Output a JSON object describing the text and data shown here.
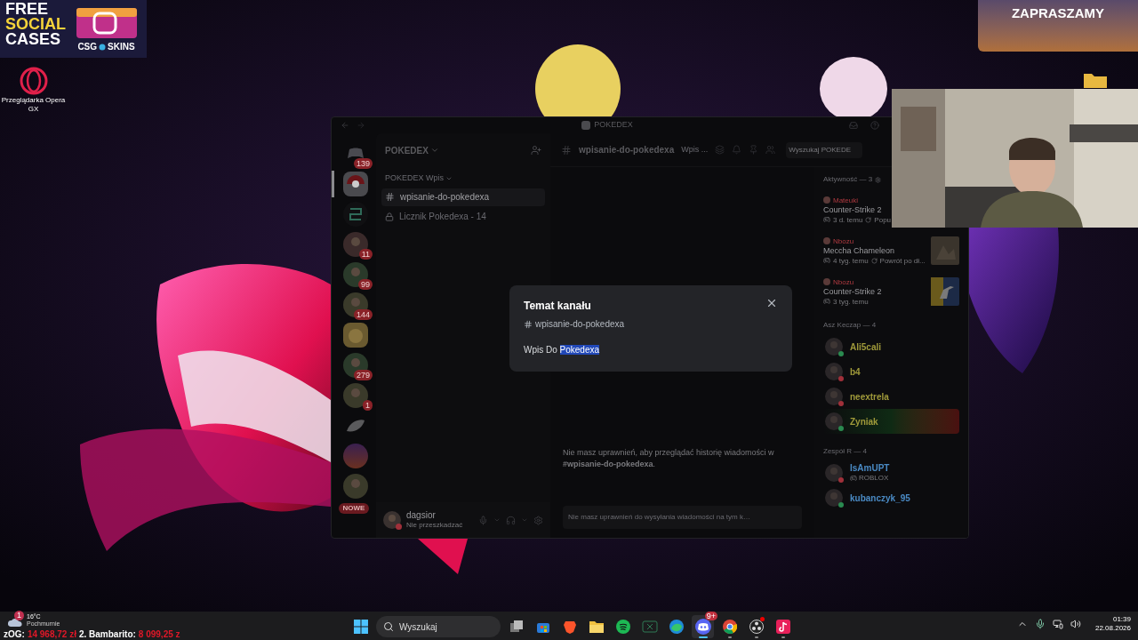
{
  "overlays": {
    "promo": {
      "lines": [
        {
          "text": "FREE",
          "color": "#ffffff"
        },
        {
          "text": "SOCIAL",
          "color": "#f5d33a"
        },
        {
          "text": "CASES",
          "color": "#ffffff"
        }
      ],
      "brand_left": "CSG",
      "brand_right": "SKINS"
    },
    "banner": {
      "title": "ZAPRASZAMY"
    },
    "ticker": [
      {
        "label": "zOG:",
        "amount": "14 968,72 zł"
      },
      {
        "label": "2. Bambarito:",
        "amount": "8 099,25 z"
      }
    ]
  },
  "desktop": {
    "icons": [
      {
        "kind": "opera",
        "label": "Przeglądarka Opera GX"
      },
      {
        "kind": "folder"
      }
    ]
  },
  "discord": {
    "title": "POKEDEX",
    "servers": [
      {
        "kind": "home",
        "badge": "139",
        "selected": false
      },
      {
        "kind": "pokeball",
        "selected": true
      },
      {
        "kind": "logo",
        "selected": false
      },
      {
        "kind": "avatar",
        "badge": "11",
        "selected": false
      },
      {
        "kind": "avatar",
        "badge": "99",
        "selected": false
      },
      {
        "kind": "avatar",
        "badge": "144",
        "selected": false
      },
      {
        "kind": "dog",
        "selected": false
      },
      {
        "kind": "avatar",
        "badge": "279",
        "selected": false
      },
      {
        "kind": "avatar",
        "badge": "1",
        "selected": false
      },
      {
        "kind": "feather",
        "selected": false
      },
      {
        "kind": "gradient",
        "selected": false
      },
      {
        "kind": "avatar",
        "selected": false
      }
    ],
    "new_pill": "NOWE",
    "server_name": "POKEDEX",
    "category": "POKEDEX Wpis",
    "channels": [
      {
        "name": "wpisanie-do-pokedexa",
        "selected": true,
        "locked": false
      },
      {
        "name": "Licznik Pokedexa - 14",
        "selected": false,
        "locked": true
      }
    ],
    "header": {
      "channel": "wpisanie-do-pokedexa",
      "topic": "Wpis ...",
      "search_placeholder": "Wyszukaj POKEDE"
    },
    "notice": "Nie masz uprawnień, aby przeglądać historię wiadomości w **#wpisanie-do-pokedexa**.",
    "composer_placeholder": "Nie masz uprawnień do wysyłania wiadomości na tym k…",
    "user": {
      "name": "dagsior",
      "status_text": "Nie przeszkadzać",
      "do_not_disturb": true
    },
    "activity": {
      "heading": "Aktywność — 3",
      "items": [
        {
          "user": "Mateuki",
          "game": "Counter-Strike 2",
          "time": "3 d. temu",
          "extra": "Popu",
          "kind": "plain"
        },
        {
          "user": "Nbozu",
          "game": "Meccha Chameleon",
          "time": "4 tyg. temu",
          "extra": "Powrót po dł..."
        },
        {
          "user": "Nbozu",
          "game": "Counter-Strike 2",
          "time": "3 tyg. temu",
          "kind": "emblem"
        }
      ]
    },
    "member_sections": [
      {
        "heading": "Asz Keczap — 4",
        "members": [
          {
            "name": "Ali5cali",
            "color": "#a09a3a",
            "do_not_disturb": false,
            "banner": false
          },
          {
            "name": "b4",
            "color": "#a09a3a",
            "do_not_disturb": true,
            "banner": false
          },
          {
            "name": "neextrela",
            "color": "#a09a3a",
            "do_not_disturb": true,
            "banner": false
          },
          {
            "name": "Zyniak",
            "color": "#a09a3a",
            "do_not_disturb": false,
            "banner": true
          }
        ]
      },
      {
        "heading": "Zespół R — 4",
        "members": [
          {
            "name": "IsAmUPT",
            "color": "#4a8ac4",
            "do_not_disturb": true,
            "banner": false,
            "activity": "ROBLOX"
          },
          {
            "name": "kubanczyk_95",
            "color": "#4a8ac4",
            "do_not_disturb": false,
            "banner": false
          }
        ]
      }
    ],
    "modal": {
      "title": "Temat kanału",
      "channel": "wpisanie-do-pokedexa",
      "topic": "Wpis Do",
      "topic_selected": "Pokedexa"
    }
  },
  "taskbar": {
    "weather": {
      "temp": "16°C",
      "condition": "Pochmurnie",
      "badge": "1"
    },
    "search_placeholder": "Wyszukaj",
    "apps": [
      {
        "kind": "taskview",
        "running": false,
        "active": false,
        "alert": false
      },
      {
        "kind": "store",
        "running": false,
        "active": false,
        "alert": false
      },
      {
        "kind": "brave",
        "running": false,
        "active": false,
        "alert": false
      },
      {
        "kind": "files",
        "running": false,
        "active": false,
        "alert": false
      },
      {
        "kind": "spotify",
        "running": false,
        "active": false,
        "alert": false
      },
      {
        "kind": "sheet",
        "running": false,
        "active": false,
        "alert": false
      },
      {
        "kind": "edge",
        "running": false,
        "active": false,
        "alert": false
      },
      {
        "kind": "discord",
        "running": true,
        "active": true,
        "alert": false,
        "badge": "9+"
      },
      {
        "kind": "chrome",
        "running": true,
        "active": false,
        "alert": false
      },
      {
        "kind": "obs",
        "running": true,
        "active": false,
        "alert": true
      },
      {
        "kind": "tiktok",
        "running": true,
        "active": false,
        "alert": false
      }
    ],
    "clock": {
      "time": "01:39",
      "date": "22.08.2026"
    }
  }
}
